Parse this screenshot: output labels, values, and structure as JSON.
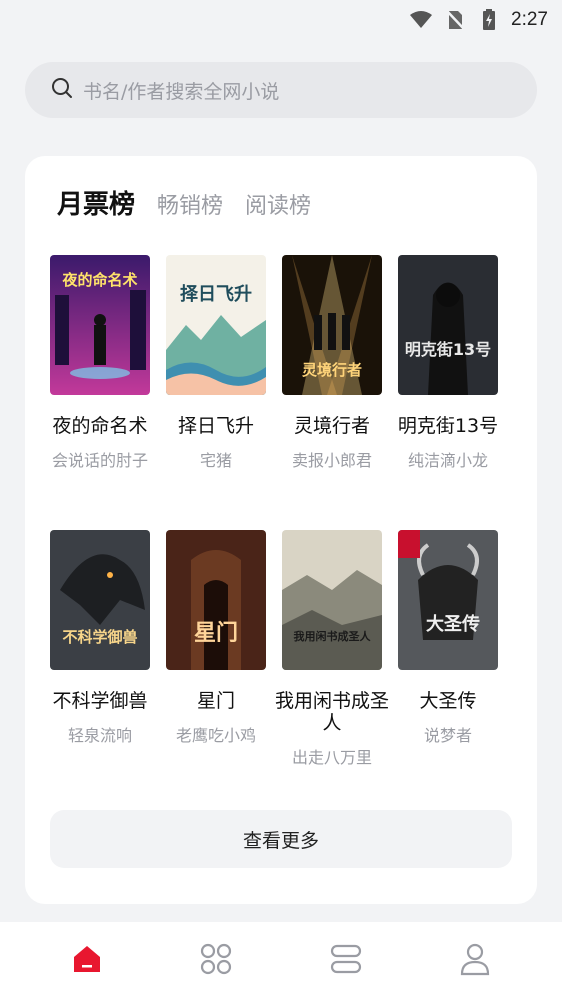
{
  "status": {
    "time": "2:27"
  },
  "search": {
    "placeholder": "书名/作者搜索全网小说"
  },
  "tabs": [
    {
      "label": "月票榜",
      "active": true
    },
    {
      "label": "畅销榜",
      "active": false
    },
    {
      "label": "阅读榜",
      "active": false
    }
  ],
  "books": [
    {
      "title": "夜的命名术",
      "author": "会说话的肘子",
      "cover_text": "夜的命名术"
    },
    {
      "title": "择日飞升",
      "author": "宅猪",
      "cover_text": "择日飞升"
    },
    {
      "title": "灵境行者",
      "author": "卖报小郎君",
      "cover_text": "灵境行者"
    },
    {
      "title": "明克街13号",
      "author": "纯洁滴小龙",
      "cover_text": "明克街13号"
    },
    {
      "title": "不科学御兽",
      "author": "轻泉流响",
      "cover_text": "不科学御兽"
    },
    {
      "title": "星门",
      "author": "老鹰吃小鸡",
      "cover_text": "星门"
    },
    {
      "title": "我用闲书成圣人",
      "author": "出走八万里",
      "cover_text": "我用闲书成圣人"
    },
    {
      "title": "大圣传",
      "author": "说梦者",
      "cover_text": "大圣传"
    }
  ],
  "more_button": {
    "label": "查看更多"
  },
  "nav": [
    {
      "name": "home",
      "active": true
    },
    {
      "name": "category",
      "active": false
    },
    {
      "name": "bookshelf",
      "active": false
    },
    {
      "name": "profile",
      "active": false
    }
  ],
  "colors": {
    "accent": "#e8172f",
    "muted": "#9a9ca3",
    "background": "#f2f3f5"
  }
}
